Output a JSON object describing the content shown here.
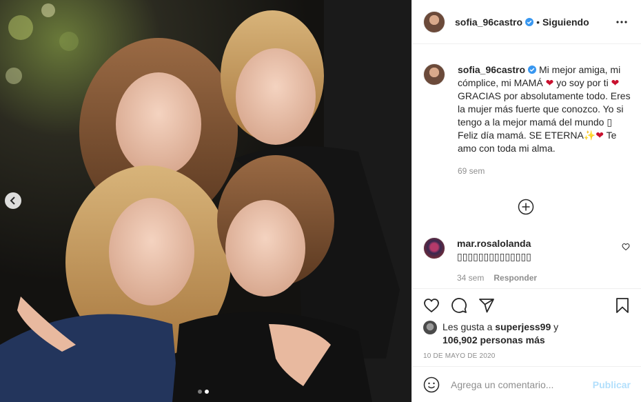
{
  "post": {
    "author": "sofia_96castro",
    "follow_separator": "•",
    "follow_label": "Siguiendo",
    "caption_parts": [
      "Mi mejor amiga, mi cómplice, mi MAMÁ ",
      " yo soy por ti ",
      "GRACIAS por absolutamente todo. Eres la mujer más fuerte que conozco. Yo si tengo a la mejor mamá del mundo ",
      " Feliz día mamá. SE ETERNA",
      " Te amo con toda mi alma."
    ],
    "caption_emojis": [
      "❤",
      "❤",
      "▯",
      "✨",
      "❤"
    ],
    "caption_time": "69 sem"
  },
  "comment": {
    "user": "mar.rosalolanda",
    "text": "▯▯▯▯▯▯▯▯▯▯▯▯▯▯",
    "time": "34 sem",
    "reply_label": "Responder"
  },
  "likes": {
    "prefix": "Les gusta a ",
    "user": "superjess99",
    "mid": " y",
    "count": "106,902 personas más"
  },
  "date": "10 DE MAYO DE 2020",
  "composer": {
    "placeholder": "Agrega un comentario...",
    "publish_label": "Publicar"
  },
  "carousel": {
    "total": 2,
    "active": 2
  },
  "colors": {
    "text": "#262626",
    "secondary": "#8e8e8e",
    "verified": "#3897f0",
    "publish_disabled": "#b2dffc",
    "border": "#efefef"
  },
  "icons": [
    "chevron-left-icon",
    "more-icon",
    "verified-icon",
    "plus-circle-icon",
    "heart-icon",
    "comment-icon",
    "share-icon",
    "bookmark-icon",
    "emoji-icon"
  ]
}
